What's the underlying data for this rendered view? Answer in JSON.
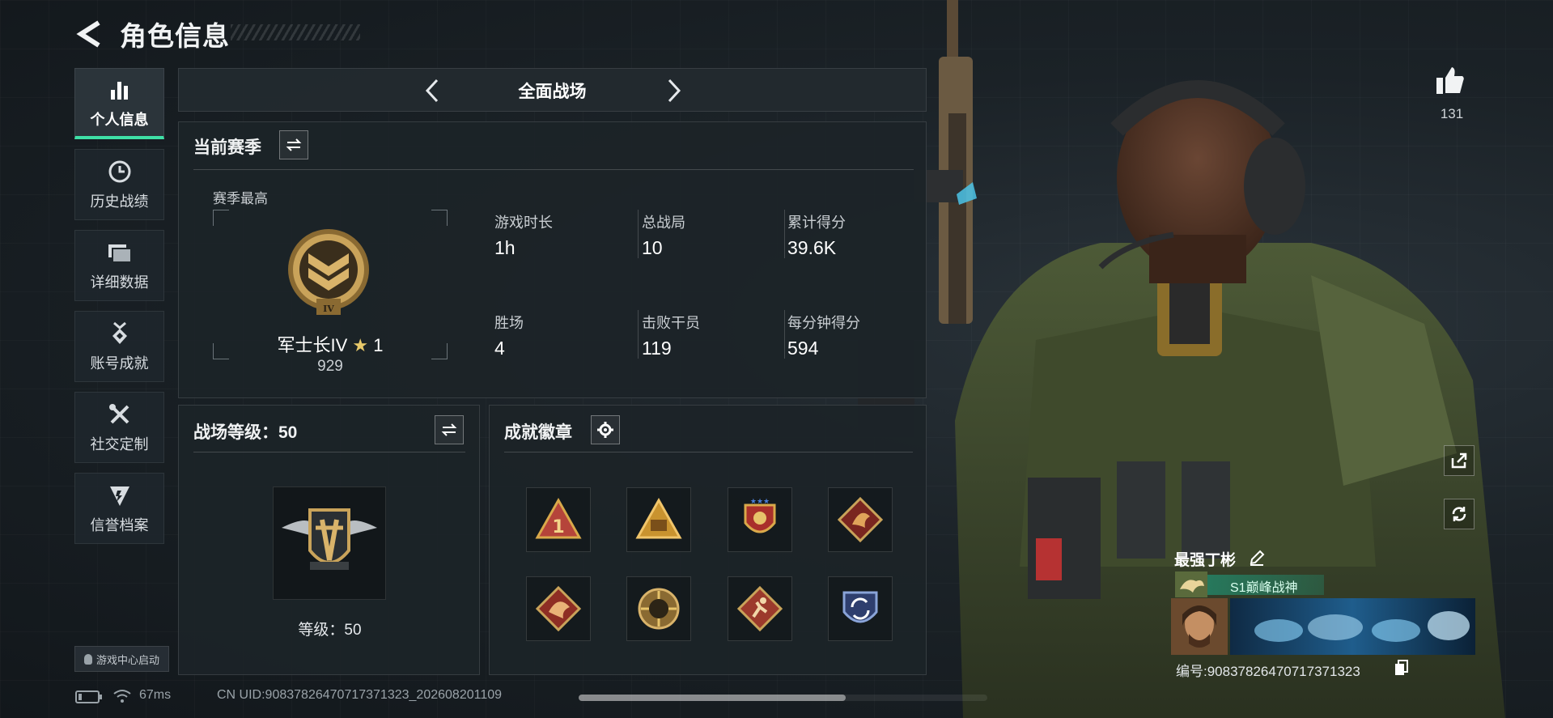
{
  "header": {
    "title": "角色信息"
  },
  "sidebar": {
    "items": [
      {
        "label": "个人信息",
        "icon": "bar-chart-icon",
        "active": true
      },
      {
        "label": "历史战绩",
        "icon": "clock-icon"
      },
      {
        "label": "详细数据",
        "icon": "folder-icon"
      },
      {
        "label": "账号成就",
        "icon": "medal-icon"
      },
      {
        "label": "社交定制",
        "icon": "tools-icon"
      },
      {
        "label": "信誉档案",
        "icon": "shield-icon"
      }
    ],
    "launcher_label": "游戏中心启动"
  },
  "mode": {
    "label": "全面战场"
  },
  "season": {
    "title": "当前赛季",
    "best_label": "赛季最高",
    "rank_name": "军士长IV",
    "rank_stars": "1",
    "rank_points": "929",
    "rank_roman": "IV",
    "stats": [
      {
        "label": "游戏时长",
        "value": "1h"
      },
      {
        "label": "总战局",
        "value": "10"
      },
      {
        "label": "累计得分",
        "value": "39.6K"
      },
      {
        "label": "胜场",
        "value": "4"
      },
      {
        "label": "击败干员",
        "value": "119"
      },
      {
        "label": "每分钟得分",
        "value": "594"
      }
    ]
  },
  "battlefield": {
    "title": "战场等级：50",
    "level_label": "等级：50"
  },
  "achievements": {
    "title": "成就徽章",
    "badges": [
      {
        "icon": "triangle-one-badge-icon"
      },
      {
        "icon": "triangle-gold-badge-icon"
      },
      {
        "icon": "shield-stars-badge-icon"
      },
      {
        "icon": "dragon-badge-icon"
      },
      {
        "icon": "dragon-red-badge-icon"
      },
      {
        "icon": "gear-sun-badge-icon"
      },
      {
        "icon": "runner-badge-icon"
      },
      {
        "icon": "cycle-shield-badge-icon"
      }
    ]
  },
  "profile": {
    "like_count": "131",
    "player_name": "最强丁彬",
    "title_tag": "S1巅峰战神",
    "id_line": "编号:90837826470717371323"
  },
  "status": {
    "ping": "67ms",
    "uid": "CN UID:90837826470717371323_202608201109"
  },
  "colors": {
    "accent": "#3ee0a6",
    "gold": "#c9a35a"
  }
}
